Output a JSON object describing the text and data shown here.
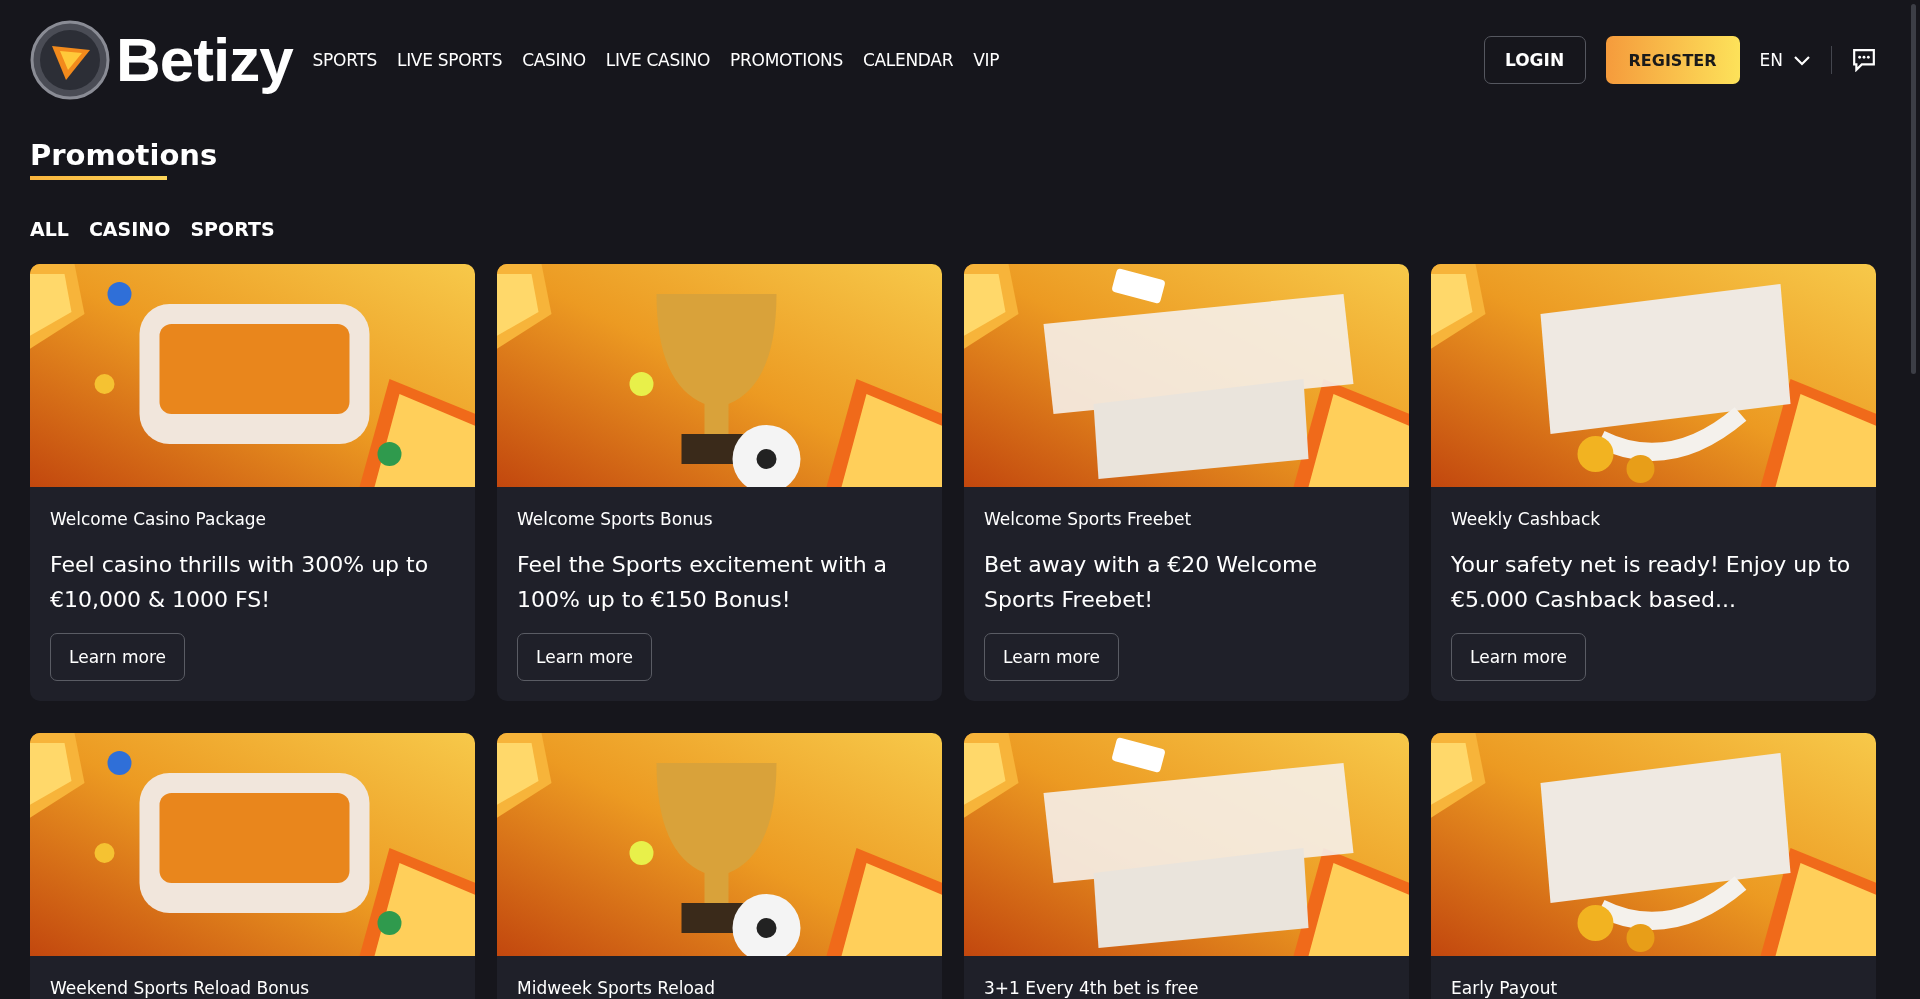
{
  "header": {
    "logo_text": "Betizy",
    "nav": [
      "SPORTS",
      "LIVE SPORTS",
      "CASINO",
      "LIVE CASINO",
      "PROMOTIONS",
      "CALENDAR",
      "VIP"
    ],
    "login": "LOGIN",
    "register": "REGISTER",
    "language": "EN"
  },
  "page_title": "Promotions",
  "filters": [
    "ALL",
    "CASINO",
    "SPORTS"
  ],
  "promotions": [
    {
      "title": "Welcome Casino Package",
      "headline": "Feel casino thrills with 300% up to €10,000 & 1000 FS!",
      "button": "Learn more"
    },
    {
      "title": "Welcome Sports Bonus",
      "headline": "Feel the Sports excitement with a 100% up to €150 Bonus!",
      "button": "Learn more"
    },
    {
      "title": "Welcome Sports Freebet",
      "headline": "Bet away with a €20 Welcome Sports Freebet!",
      "button": "Learn more"
    },
    {
      "title": "Weekly Cashback",
      "headline": "Your safety net is ready! Enjoy up to €5.000 Cashback based...",
      "button": "Learn more"
    },
    {
      "title": "Weekend Sports Reload Bonus"
    },
    {
      "title": "Midweek Sports Reload"
    },
    {
      "title": "3+1 Every 4th bet is free"
    },
    {
      "title": "Early Payout"
    }
  ]
}
